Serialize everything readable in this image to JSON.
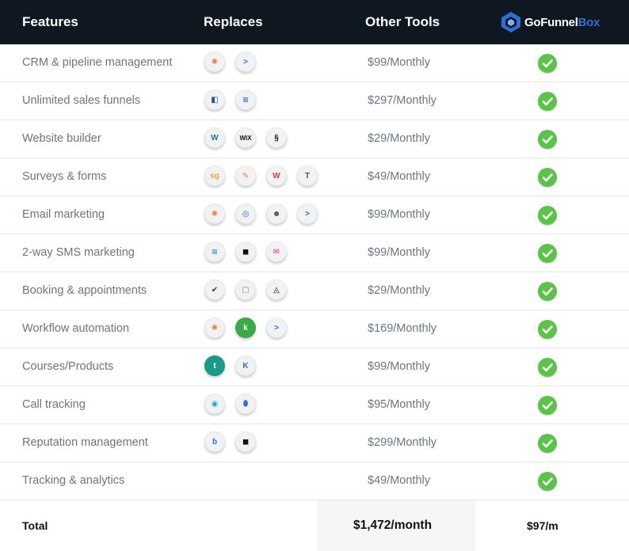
{
  "header": {
    "features": "Features",
    "replaces": "Replaces",
    "other_tools": "Other Tools",
    "brand_go": "GoFunnel",
    "brand_box": "Box"
  },
  "colors": {
    "header_bg": "#0f1720",
    "check": "#5bc24a",
    "brand_blue": "#2f6fd8"
  },
  "rows": [
    {
      "feature": "CRM & pipeline management",
      "price": "$99/Monthly",
      "included": true,
      "icons": [
        {
          "name": "hubspot-icon",
          "glyph": "✺",
          "color": "#f57c35"
        },
        {
          "name": "activecampaign-icon",
          "glyph": ">",
          "color": "#356ae6"
        }
      ]
    },
    {
      "feature": "Unlimited sales funnels",
      "price": "$297/Monthly",
      "included": true,
      "icons": [
        {
          "name": "clickfunnels-icon",
          "glyph": "◧",
          "color": "#2b4e8c"
        },
        {
          "name": "layers-icon",
          "glyph": "≋",
          "color": "#2f6fd8"
        }
      ]
    },
    {
      "feature": "Website builder",
      "price": "$29/Monthly",
      "included": true,
      "icons": [
        {
          "name": "wordpress-icon",
          "glyph": "W",
          "color": "#21759b"
        },
        {
          "name": "wix-icon",
          "glyph": "WIX",
          "color": "#111111"
        },
        {
          "name": "squarespace-icon",
          "glyph": "§",
          "color": "#111111"
        }
      ]
    },
    {
      "feature": "Surveys & forms",
      "price": "$49/Monthly",
      "included": true,
      "icons": [
        {
          "name": "surveygizmo-icon",
          "glyph": "sg",
          "color": "#f2a33a"
        },
        {
          "name": "jotform-icon",
          "glyph": "✎",
          "color": "#f58220"
        },
        {
          "name": "wufoo-icon",
          "glyph": "W",
          "color": "#e4382f"
        },
        {
          "name": "typeform-icon",
          "glyph": "T",
          "color": "#555555"
        }
      ]
    },
    {
      "feature": "Email marketing",
      "price": "$99/Monthly",
      "included": true,
      "icons": [
        {
          "name": "hubspot-icon",
          "glyph": "✺",
          "color": "#f57c35"
        },
        {
          "name": "constant-contact-icon",
          "glyph": "◎",
          "color": "#1f6fd1"
        },
        {
          "name": "mailchimp-icon",
          "glyph": "☻",
          "color": "#5a4a3a"
        },
        {
          "name": "activecampaign-icon",
          "glyph": ">",
          "color": "#356ae6"
        }
      ]
    },
    {
      "feature": "2-way SMS marketing",
      "price": "$99/Monthly",
      "included": true,
      "icons": [
        {
          "name": "stacked-waves-icon",
          "glyph": "≋",
          "color": "#3c8fd6"
        },
        {
          "name": "podium-icon",
          "glyph": "◼",
          "color": "#111111"
        },
        {
          "name": "sms-mail-icon",
          "glyph": "✉",
          "color": "#ec3a6b"
        }
      ]
    },
    {
      "feature": "Booking & appointments",
      "price": "$29/Monthly",
      "included": true,
      "icons": [
        {
          "name": "calendly-check-icon",
          "glyph": "✔",
          "color": "#333333"
        },
        {
          "name": "blank-square-icon",
          "glyph": "▢",
          "color": "#888888"
        },
        {
          "name": "acuity-icon",
          "glyph": "◬",
          "color": "#111111"
        }
      ]
    },
    {
      "feature": "Workflow automation",
      "price": "$169/Monthly",
      "included": true,
      "icons": [
        {
          "name": "hubspot-icon",
          "glyph": "✺",
          "color": "#f57c35"
        },
        {
          "name": "keap-icon",
          "glyph": "k",
          "color": "#ffffff",
          "bg": "#3bab49"
        },
        {
          "name": "activecampaign-icon",
          "glyph": ">",
          "color": "#356ae6"
        }
      ]
    },
    {
      "feature": "Courses/Products",
      "price": "$99/Monthly",
      "included": true,
      "icons": [
        {
          "name": "teachable-icon",
          "glyph": "t",
          "color": "#ffffff",
          "bg": "#1a9a8a"
        },
        {
          "name": "kajabi-icon",
          "glyph": "K",
          "color": "#2f6fd8"
        }
      ]
    },
    {
      "feature": "Call tracking",
      "price": "$95/Monthly",
      "included": true,
      "icons": [
        {
          "name": "call-rail-icon",
          "glyph": "◉",
          "color": "#24a6cc"
        },
        {
          "name": "location-pin-icon",
          "glyph": "⬮",
          "color": "#2f6fd8"
        }
      ]
    },
    {
      "feature": "Reputation management",
      "price": "$299/Monthly",
      "included": true,
      "icons": [
        {
          "name": "birdeye-icon",
          "glyph": "ɓ",
          "color": "#2f6fd8"
        },
        {
          "name": "podium-icon",
          "glyph": "◼",
          "color": "#111111"
        }
      ]
    },
    {
      "feature": "Tracking & analytics",
      "price": "$49/Monthly",
      "included": true,
      "icons": []
    }
  ],
  "total": {
    "label": "Total",
    "other": "$1,472/month",
    "ours": "$97/m"
  }
}
